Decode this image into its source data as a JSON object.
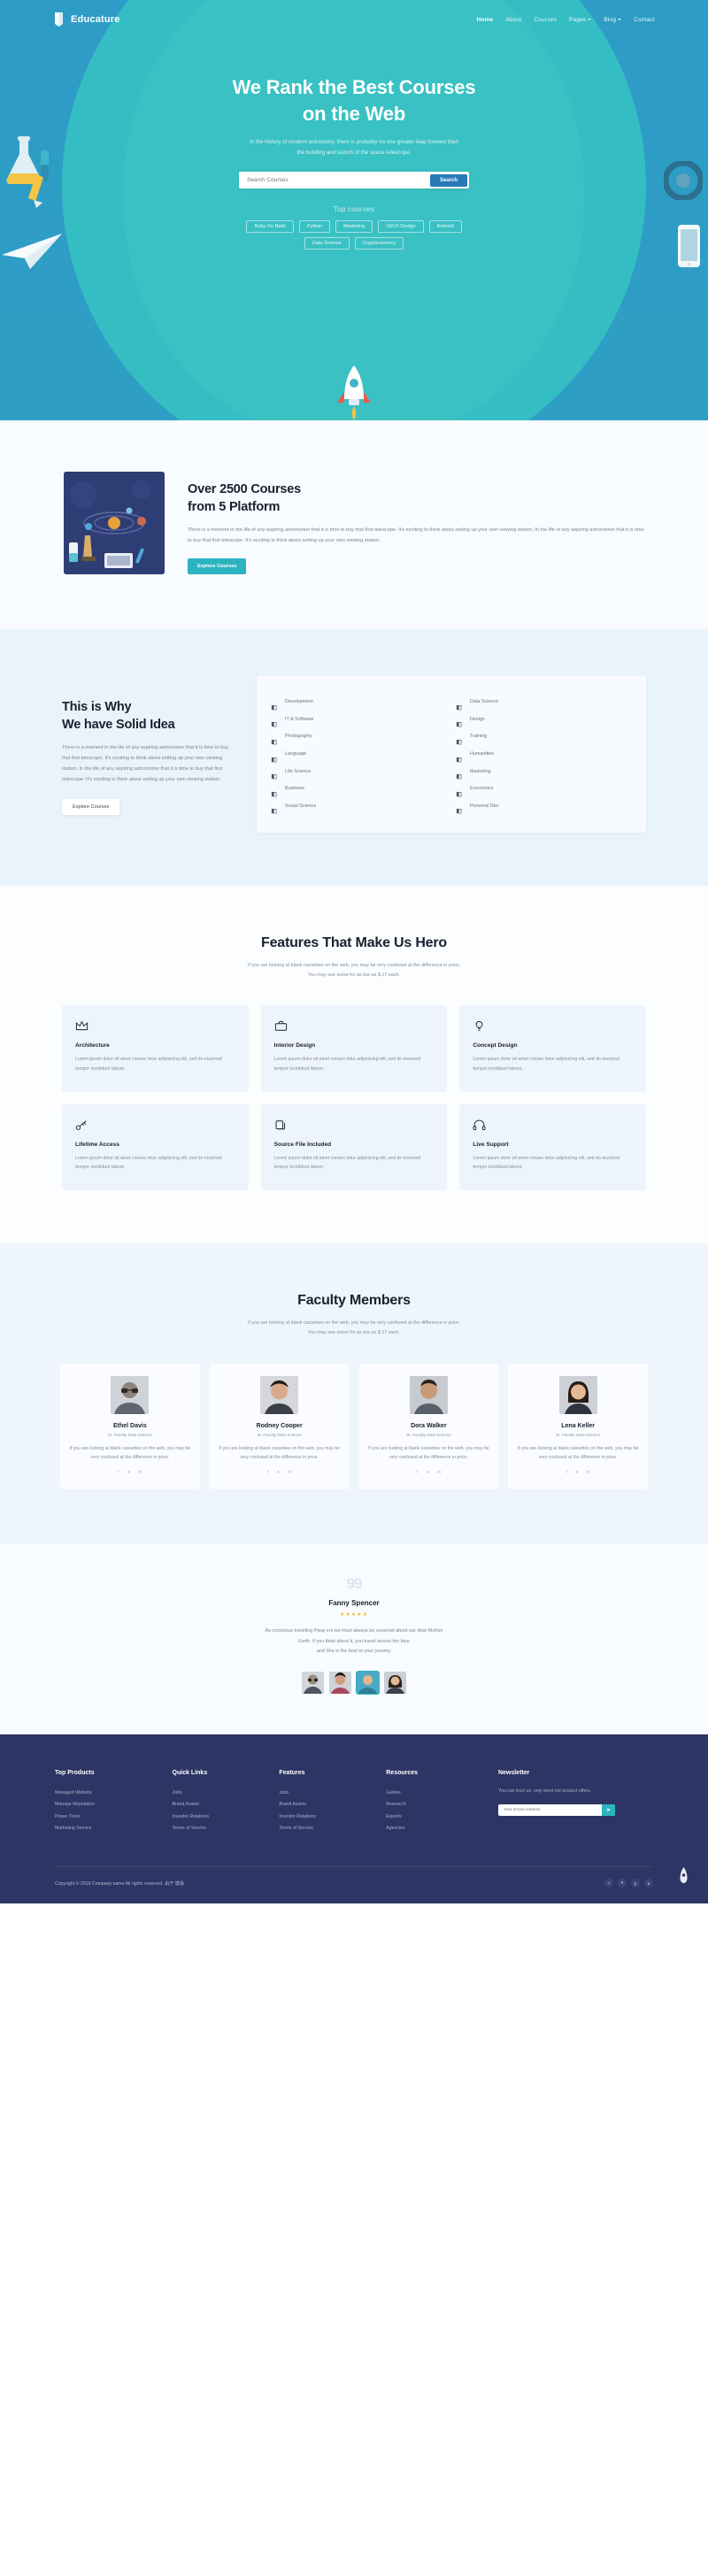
{
  "brand": {
    "name": "Educature",
    "logo_icon": "book-logo-icon"
  },
  "nav": {
    "items": [
      {
        "label": "Home",
        "active": true,
        "caret": false
      },
      {
        "label": "About",
        "active": false,
        "caret": false
      },
      {
        "label": "Courses",
        "active": false,
        "caret": false
      },
      {
        "label": "Pages",
        "active": false,
        "caret": true
      },
      {
        "label": "Blog",
        "active": false,
        "caret": true
      },
      {
        "label": "Contact",
        "active": false,
        "caret": false
      }
    ]
  },
  "hero": {
    "title_line1": "We Rank the Best Courses",
    "title_line2": "on the Web",
    "subtitle_line1": "In the history of modern astronomy, there is probably no one greater leap forward than",
    "subtitle_line2": "the building and launch of the space telescope.",
    "search_placeholder": "Search Courses",
    "search_value": "",
    "search_button": "Search",
    "top_courses_label": "Top courses",
    "tags": [
      "Ruby On Rails",
      "Python",
      "Marketing",
      "UI/UX Design",
      "Android",
      "Data Science",
      "Cryptocurrency"
    ],
    "bg_color": "#2f9ec5",
    "blob_color": "#36bfc4"
  },
  "courses_section": {
    "title_line1": "Over 2500 Courses",
    "title_line2": "from 5 Platform",
    "body": "There is a moment in the life of any aspiring astronomer that it is time to buy that first telescope. It's exciting to think about setting up your own viewing station. In the life of any aspiring astronomer that it is time to buy that first telescope. It's exciting to think about setting up your own viewing station.",
    "button": "Explore Courses",
    "image_name": "science-illustration"
  },
  "why_section": {
    "title_line1": "This is Why",
    "title_line2": "We have Solid Idea",
    "body": "There is a moment in the life of any aspiring astronomer that it is time to buy that first telescope. It's exciting to think about setting up your own viewing station. In the life of any aspiring astronomer that it is time to buy that first telescope. It's exciting to think about setting up your own viewing station.",
    "button": "Explore Courses",
    "categories_left": [
      "Development",
      "IT & Software",
      "Photography",
      "Language",
      "Life Science",
      "Business",
      "Social Science"
    ],
    "categories_right": [
      "Data Science",
      "Design",
      "Training",
      "Humanities",
      "Marketing",
      "Economics",
      "Personal Dev"
    ]
  },
  "features_section": {
    "title": "Features That Make Us Hero",
    "sub_line1": "If you are looking at blank cassettes on the web, you may be very confused at the difference in price.",
    "sub_line2": "You may see some for as low as $.17 each.",
    "body_text": "Lorem ipsum dolor sit amet consec tetur adipisicing elit, sed do eiusmod tempor incididunt labore.",
    "cards": [
      {
        "icon": "crown-icon",
        "title": "Architecture"
      },
      {
        "icon": "briefcase-icon",
        "title": "Interior Design"
      },
      {
        "icon": "lightbulb-icon",
        "title": "Concept Design"
      },
      {
        "icon": "key-icon",
        "title": "Lifetime Access"
      },
      {
        "icon": "file-copy-icon",
        "title": "Source File Included"
      },
      {
        "icon": "headset-icon",
        "title": "Live Support"
      }
    ]
  },
  "faculty_section": {
    "title": "Faculty Members",
    "sub_line1": "If you are looking at blank cassettes on the web, you may be very confused at the difference in price.",
    "sub_line2": "You may see some for as low as $.17 each.",
    "member_text": "If you are looking at blank cassettes on the web, you may be very confused at the difference in price.",
    "role": "Sr. Faculty Data Science",
    "members": [
      {
        "name": "Ethel Davis",
        "photo": "man-glasses-photo"
      },
      {
        "name": "Rodney Cooper",
        "photo": "man-dark-hair-photo"
      },
      {
        "name": "Dora Walker",
        "photo": "man-portrait-photo"
      },
      {
        "name": "Lena Keller",
        "photo": "woman-portrait-photo"
      }
    ],
    "social_icons": [
      "facebook-icon",
      "twitter-icon",
      "linkedin-icon"
    ]
  },
  "testimonial_section": {
    "quote_mark": "99",
    "name": "Fanny Spencer",
    "stars": "★★★★★",
    "rating": 5,
    "text_line1": "As conscious traveling Paup ers we must always be uncornet about our dear Mother",
    "text_line2": "Earth. If you think about it, you travel across her face",
    "text_line3": "and She is the host to your journey.",
    "avatars": [
      {
        "name": "avatar-1",
        "active": false
      },
      {
        "name": "avatar-2",
        "active": false
      },
      {
        "name": "avatar-3",
        "active": true
      },
      {
        "name": "avatar-4",
        "active": false
      }
    ]
  },
  "footer": {
    "columns": [
      {
        "heading": "Top Products",
        "links": [
          "Managed Website",
          "Manage Reputation",
          "Power Tools",
          "Marketing Service"
        ]
      },
      {
        "heading": "Quick Links",
        "links": [
          "Jobs",
          "Brand Assets",
          "Investor Relations",
          "Terms of Service"
        ]
      },
      {
        "heading": "Features",
        "links": [
          "Jobs",
          "Brand Assets",
          "Investor Relations",
          "Terms of Service"
        ]
      },
      {
        "heading": "Resources",
        "links": [
          "Guides",
          "Research",
          "Experts",
          "Agencies"
        ]
      }
    ],
    "newsletter": {
      "heading": "Newsletter",
      "text": "You can trust us. only send not product offers.",
      "placeholder": "Your Email Address",
      "value": "",
      "button_icon": "send-icon"
    },
    "copyright": "Copyright © 2019 Company name All rights reserved.",
    "credit": "由于 模板",
    "social": [
      "facebook-icon",
      "twitter-icon",
      "pinterest-icon",
      "behance-icon"
    ],
    "scroll_top_icon": "scroll-top-icon",
    "bg_color": "#2c3563"
  }
}
